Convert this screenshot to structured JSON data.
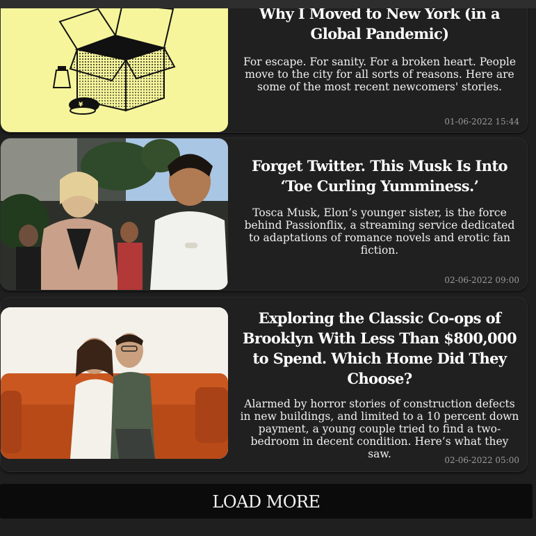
{
  "articles": [
    {
      "title": "Why I Moved to New York (in a Global Pandemic)",
      "description": "For escape. For sanity. For a broken heart. People move to the city for all sorts of reasons. Here are some of the most recent newcomers' stories.",
      "date": "01-06-2022 15:44",
      "image_icon": "moving-box-illustration"
    },
    {
      "title": "Forget Twitter. This Musk Is Into ‘Toe Curling Yumminess.’",
      "description": "Tosca Musk, Elon’s younger sister, is the force behind Passionflix, a streaming service dedicated to adaptations of romance novels and erotic fan fiction.",
      "date": "02-06-2022 09:00",
      "image_icon": "party-couple-photo"
    },
    {
      "title": "Exploring the Classic Co-ops of Brooklyn With Less Than $800,000 to Spend. Which Home Did They Choose?",
      "description": "Alarmed by horror stories of construction defects in new buildings, and limited to a 10 percent down payment, a young couple tried to find a two-bedroom in decent condition. Here’s what they saw.",
      "date": "02-06-2022 05:00",
      "image_icon": "couple-on-sofa-photo"
    }
  ],
  "load_more_label": "LOAD MORE",
  "colors": {
    "background": "#1f1f1f",
    "card": "#202020",
    "button": "#0b0b0b",
    "illustration_bg": "#f6f59b"
  }
}
